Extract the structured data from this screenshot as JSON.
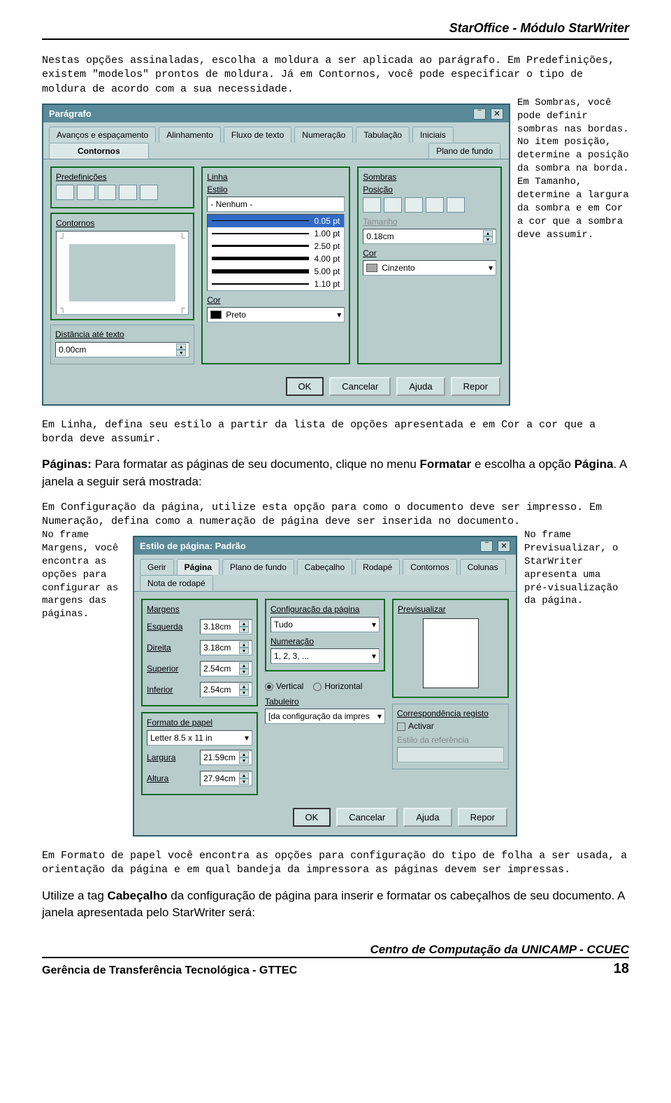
{
  "header_title": "StarOffice - Módulo StarWriter",
  "intro_text": "Nestas opções assinaladas, escolha a moldura a ser aplicada ao parágrafo. Em Predefinições, existem \"modelos\" prontos de moldura. Já em Contornos, você pode especificar o tipo de moldura de acordo com a sua necessidade.",
  "side_note_1": "Em Sombras, você pode definir sombras nas bordas. No item posição, determine a posição da sombra na borda. Em Tamanho, determine a largura da sombra e em Cor a cor que a sombra deve assumir.",
  "post_dialog_1": "Em Linha, defina seu estilo a partir da lista de opções apresentada e em Cor a cor que a borda deve assumir.",
  "paginas_text_1": "Páginas: ",
  "paginas_text_2": "Para formatar as páginas de seu documento, clique no menu ",
  "paginas_text_3": "Formatar",
  "paginas_text_4": " e escolha a opção ",
  "paginas_text_5": "Página",
  "paginas_text_6": ". A janela a seguir será mostrada:",
  "pg_intro": "Em Configuração da página, utilize esta opção para como o documento deve ser impresso. Em Numeração, defina como a numeração de página deve ser inserida no documento.",
  "side_note_left": "No frame Margens, você encontra as opções para configurar as margens das páginas.",
  "side_note_right2": "No frame Previsualizar, o StarWriter apresenta uma pré-visualização da página.",
  "post_dialog_2": "Em Formato de papel você encontra as opções para configuração do tipo de folha a ser usada, a orientação da página e em qual bandeja da impressora as páginas devem ser impressas.",
  "cabecalho_text_1": "Utilize a tag ",
  "cabecalho_text_2": "Cabeçalho",
  "cabecalho_text_3": " da configuração de página para inserir e formatar os cabeçalhos de seu documento. A janela apresentada pelo StarWriter será:",
  "dialog1": {
    "title": "Parágrafo",
    "tabs_row1": [
      "Avanços e espaçamento",
      "Alinhamento",
      "Fluxo de texto",
      "Numeração",
      "Tabulação",
      "Iniciais"
    ],
    "tabs_row2": [
      "Contornos",
      "Plano de fundo"
    ],
    "active_tab": "Contornos",
    "predefs_label": "Predefinições",
    "contornos_label": "Contornos",
    "distancia_label": "Distância até texto",
    "distancia_value": "0.00cm",
    "linha_label": "Linha",
    "estilo_label": "Estilo",
    "estilo_value": "- Nenhum -",
    "line_options": [
      "0.05 pt",
      "1.00 pt",
      "2.50 pt",
      "4.00 pt",
      "5.00 pt",
      "1.10 pt"
    ],
    "line_selected": "0.05 pt",
    "cor_label": "Cor",
    "cor_value": "Preto",
    "cor_color": "#000000",
    "sombras_label": "Sombras",
    "posicao_label": "Posição",
    "tamanho_label": "Tamanho",
    "tamanho_value": "0.18cm",
    "sombra_cor_label": "Cor",
    "sombra_cor_value": "Cinzento",
    "sombra_cor_color": "#a8a8a8",
    "buttons": {
      "ok": "OK",
      "cancel": "Cancelar",
      "help": "Ajuda",
      "reset": "Repor"
    }
  },
  "dialog2": {
    "title": "Estilo de página: Padrão",
    "tabs": [
      "Gerir",
      "Página",
      "Plano de fundo",
      "Cabeçalho",
      "Rodapé",
      "Contornos",
      "Colunas",
      "Nota de rodapé"
    ],
    "active_tab": "Página",
    "margens_label": "Margens",
    "esquerda_label": "Esquerda",
    "esquerda_value": "3.18cm",
    "direita_label": "Direita",
    "direita_value": "3.18cm",
    "superior_label": "Superior",
    "superior_value": "2.54cm",
    "inferior_label": "Inferior",
    "inferior_value": "2.54cm",
    "config_label": "Configuração da página",
    "config_value": "Tudo",
    "numeracao_label": "Numeração",
    "numeracao_value": "1, 2, 3, ...",
    "previsualizar_label": "Previsualizar",
    "formato_label": "Formato de papel",
    "formato_value": "Letter 8.5 x 11 in",
    "largura_label": "Largura",
    "largura_value": "21.59cm",
    "altura_label": "Altura",
    "altura_value": "27.94cm",
    "vertical_label": "Vertical",
    "horizontal_label": "Horizontal",
    "tabuleiro_label": "Tabuleiro",
    "tabuleiro_value": "[da configuração da impres",
    "corresp_label": "Correspondência registo",
    "activar_label": "Activar",
    "estilo_ref_label": "Estilo da referência",
    "buttons": {
      "ok": "OK",
      "cancel": "Cancelar",
      "help": "Ajuda",
      "reset": "Repor"
    }
  },
  "footer": {
    "center": "Centro de Computação da UNICAMP - CCUEC",
    "left": "Gerência de Transferência Tecnológica - GTTEC",
    "page": "18"
  }
}
